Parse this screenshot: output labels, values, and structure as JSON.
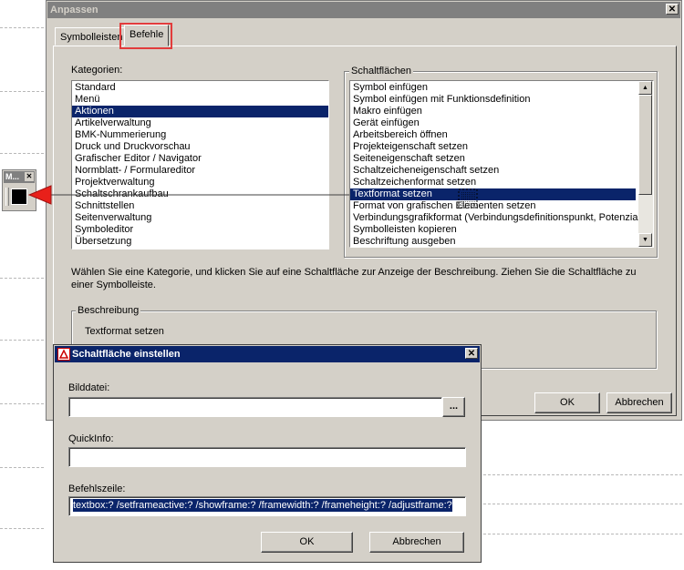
{
  "main_dialog": {
    "title": "Anpassen",
    "close": "✕",
    "tabs": [
      {
        "label": "Symbolleisten"
      },
      {
        "label": "Befehle"
      }
    ],
    "categories_label": "Kategorien:",
    "categories": [
      "Standard",
      "Menü",
      "Aktionen",
      "Artikelverwaltung",
      "BMK-Nummerierung",
      "Druck und Druckvorschau",
      "Grafischer Editor / Navigator",
      "Normblatt- / Formulareditor",
      "Projektverwaltung",
      "Schaltschrankaufbau",
      "Schnittstellen",
      "Seitenverwaltung",
      "Symboleditor",
      "Übersetzung"
    ],
    "selected_category": "Aktionen",
    "buttons_group_label": "Schaltflächen",
    "buttons_list": [
      "Symbol einfügen",
      "Symbol einfügen mit Funktionsdefinition",
      "Makro einfügen",
      "Gerät einfügen",
      "Arbeitsbereich öffnen",
      "Projekteigenschaft setzen",
      "Seiteneigenschaft setzen",
      "Schaltzeicheneigenschaft setzen",
      "Schaltzeichenformat setzen",
      "Textformat setzen",
      "Format von grafischen Elementen setzen",
      "Verbindungsgrafikformat (Verbindungsdefinitionspunkt, Potenzialde",
      "Symbolleisten kopieren",
      "Beschriftung ausgeben"
    ],
    "selected_button": "Textformat setzen",
    "help_text": "Wählen Sie eine Kategorie, und klicken Sie auf eine Schaltfläche zur Anzeige der Beschreibung. Ziehen Sie die Schaltfläche zu einer Symbolleiste.",
    "description_label": "Beschreibung",
    "description_text": "Textformat setzen",
    "ok_label": "OK",
    "cancel_label": "Abbrechen"
  },
  "mini_toolbar": {
    "title": "M...",
    "close": "✕"
  },
  "button_dialog": {
    "title": "Schaltfläche einstellen",
    "close": "✕",
    "image_label": "Bilddatei:",
    "image_value": "",
    "browse_label": "...",
    "quickinfo_label": "QuickInfo:",
    "quickinfo_value": "",
    "command_label": "Befehlszeile:",
    "command_value": "textbox:? /setframeactive:? /showframe:? /framewidth:? /frameheight:? /adjustframe:?",
    "ok_label": "OK",
    "cancel_label": "Abbrechen"
  },
  "colors": {
    "selection": "#0a246a",
    "highlight_box": "#e23c3c",
    "arrow": "#e8201a"
  }
}
